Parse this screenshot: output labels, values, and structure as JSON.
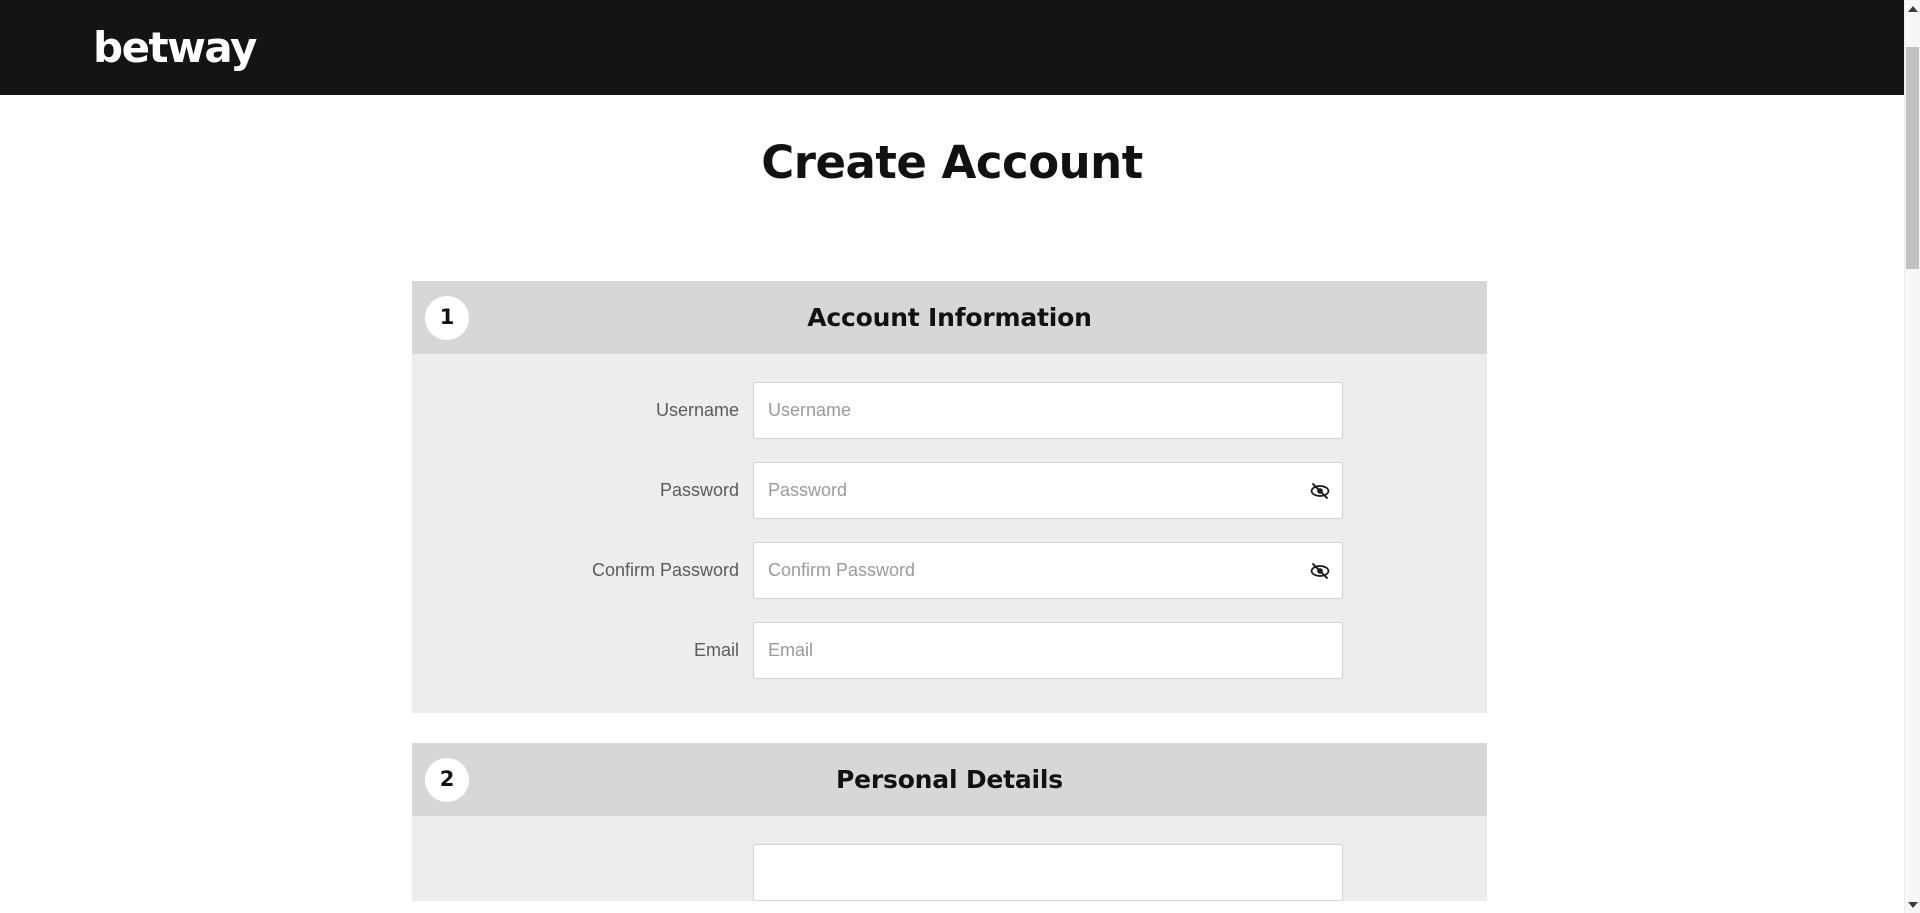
{
  "brand": {
    "logo_text": "betway"
  },
  "page": {
    "title": "Create Account"
  },
  "colors": {
    "topbar_background": "#141414",
    "logo_text": "#ffffff",
    "page_background": "#ffffff",
    "section_header_background": "#d7d7d7",
    "section_body_background": "#ededed",
    "input_background": "#ffffff",
    "input_border": "#d3d3d3",
    "label_text": "#5b5b5b",
    "placeholder_text": "#9a9a9a",
    "title_text": "#111111",
    "scrollbar_thumb": "#c1c1c1"
  },
  "sections": [
    {
      "number": "1",
      "title": "Account Information",
      "fields": [
        {
          "label": "Username",
          "placeholder": "Username",
          "value": "",
          "type": "text",
          "has_visibility_toggle": false
        },
        {
          "label": "Password",
          "placeholder": "Password",
          "value": "",
          "type": "password",
          "has_visibility_toggle": true,
          "toggle_icon": "eye-off-icon"
        },
        {
          "label": "Confirm Password",
          "placeholder": "Confirm Password",
          "value": "",
          "type": "password",
          "has_visibility_toggle": true,
          "toggle_icon": "eye-off-icon"
        },
        {
          "label": "Email",
          "placeholder": "Email",
          "value": "",
          "type": "email",
          "has_visibility_toggle": false
        }
      ]
    },
    {
      "number": "2",
      "title": "Personal Details",
      "fields": []
    }
  ],
  "scrollbar": {
    "up_arrow_icon": "caret-up-icon",
    "down_arrow_icon": "caret-down-icon",
    "thumb_position_percent": 5
  }
}
